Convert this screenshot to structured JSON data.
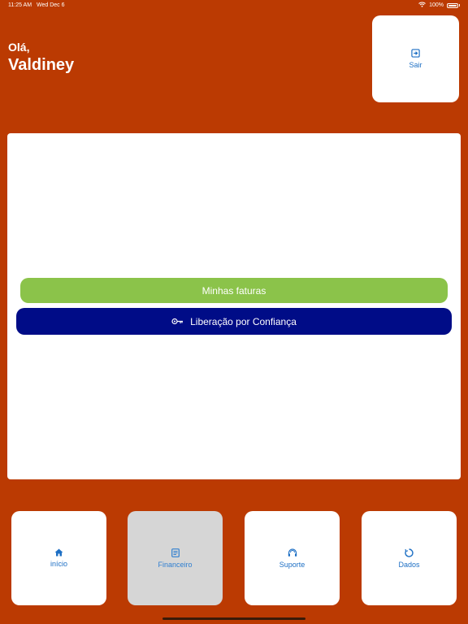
{
  "status_bar": {
    "time": "11:25 AM",
    "date": "Wed Dec 6",
    "battery_text": "100%",
    "battery_level_percent": 100
  },
  "greeting": {
    "hello": "Olá,",
    "name": "Valdiney"
  },
  "header": {
    "logout_label": "Sair",
    "logout_icon": "logout-icon"
  },
  "main": {
    "invoices_label": "Minhas faturas",
    "trust_release_label": "Liberação por Confiança",
    "trust_release_icon": "key-icon"
  },
  "nav": {
    "tabs": [
      {
        "label": "início",
        "icon": "home-icon",
        "active": false
      },
      {
        "label": "Financeiro",
        "icon": "document-icon",
        "active": true
      },
      {
        "label": "Suporte",
        "icon": "support-icon",
        "active": false
      },
      {
        "label": "Dados",
        "icon": "data-icon",
        "active": false
      }
    ]
  },
  "colors": {
    "background": "#bb3a02",
    "card": "#ffffff",
    "invoices_button": "#8bc34a",
    "trust_button": "#000c87",
    "accent_text": "#1d6fc4",
    "active_tab": "#d6d6d6"
  }
}
